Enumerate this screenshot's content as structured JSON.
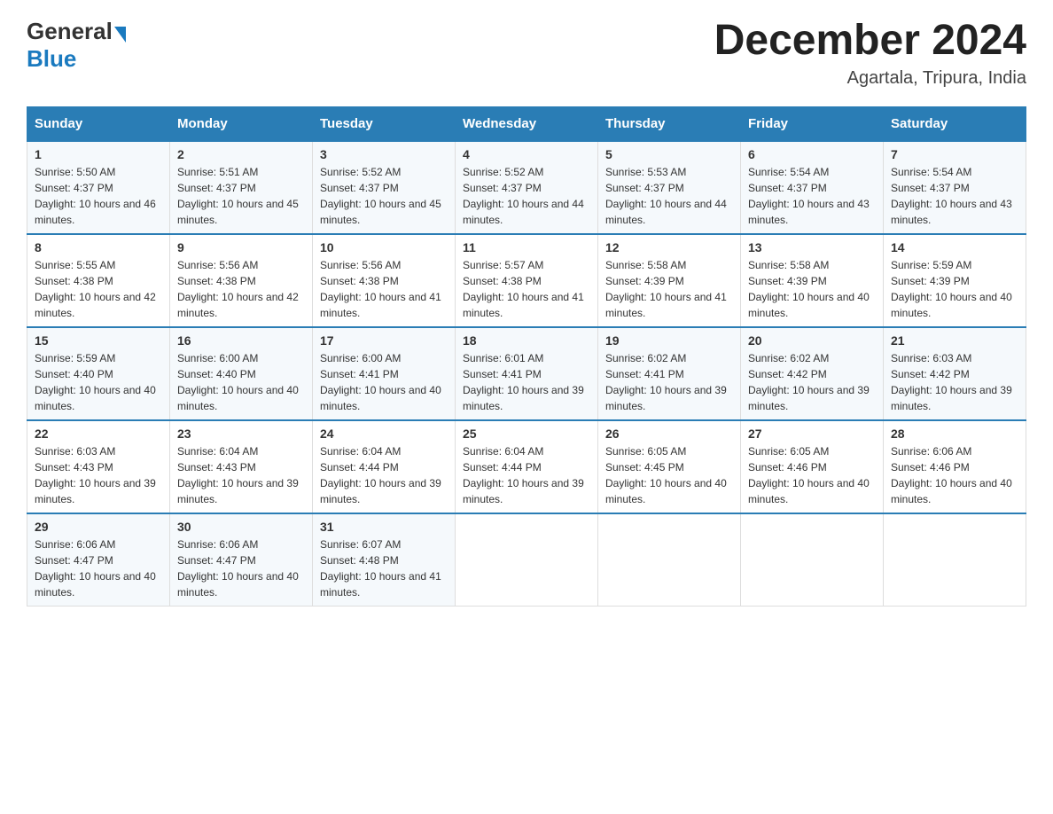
{
  "header": {
    "logo": {
      "general": "General",
      "blue": "Blue",
      "triangle": "▶"
    },
    "title": "December 2024",
    "subtitle": "Agartala, Tripura, India"
  },
  "calendar": {
    "headers": [
      "Sunday",
      "Monday",
      "Tuesday",
      "Wednesday",
      "Thursday",
      "Friday",
      "Saturday"
    ],
    "weeks": [
      [
        {
          "day": "1",
          "sunrise": "5:50 AM",
          "sunset": "4:37 PM",
          "daylight": "10 hours and 46 minutes."
        },
        {
          "day": "2",
          "sunrise": "5:51 AM",
          "sunset": "4:37 PM",
          "daylight": "10 hours and 45 minutes."
        },
        {
          "day": "3",
          "sunrise": "5:52 AM",
          "sunset": "4:37 PM",
          "daylight": "10 hours and 45 minutes."
        },
        {
          "day": "4",
          "sunrise": "5:52 AM",
          "sunset": "4:37 PM",
          "daylight": "10 hours and 44 minutes."
        },
        {
          "day": "5",
          "sunrise": "5:53 AM",
          "sunset": "4:37 PM",
          "daylight": "10 hours and 44 minutes."
        },
        {
          "day": "6",
          "sunrise": "5:54 AM",
          "sunset": "4:37 PM",
          "daylight": "10 hours and 43 minutes."
        },
        {
          "day": "7",
          "sunrise": "5:54 AM",
          "sunset": "4:37 PM",
          "daylight": "10 hours and 43 minutes."
        }
      ],
      [
        {
          "day": "8",
          "sunrise": "5:55 AM",
          "sunset": "4:38 PM",
          "daylight": "10 hours and 42 minutes."
        },
        {
          "day": "9",
          "sunrise": "5:56 AM",
          "sunset": "4:38 PM",
          "daylight": "10 hours and 42 minutes."
        },
        {
          "day": "10",
          "sunrise": "5:56 AM",
          "sunset": "4:38 PM",
          "daylight": "10 hours and 41 minutes."
        },
        {
          "day": "11",
          "sunrise": "5:57 AM",
          "sunset": "4:38 PM",
          "daylight": "10 hours and 41 minutes."
        },
        {
          "day": "12",
          "sunrise": "5:58 AM",
          "sunset": "4:39 PM",
          "daylight": "10 hours and 41 minutes."
        },
        {
          "day": "13",
          "sunrise": "5:58 AM",
          "sunset": "4:39 PM",
          "daylight": "10 hours and 40 minutes."
        },
        {
          "day": "14",
          "sunrise": "5:59 AM",
          "sunset": "4:39 PM",
          "daylight": "10 hours and 40 minutes."
        }
      ],
      [
        {
          "day": "15",
          "sunrise": "5:59 AM",
          "sunset": "4:40 PM",
          "daylight": "10 hours and 40 minutes."
        },
        {
          "day": "16",
          "sunrise": "6:00 AM",
          "sunset": "4:40 PM",
          "daylight": "10 hours and 40 minutes."
        },
        {
          "day": "17",
          "sunrise": "6:00 AM",
          "sunset": "4:41 PM",
          "daylight": "10 hours and 40 minutes."
        },
        {
          "day": "18",
          "sunrise": "6:01 AM",
          "sunset": "4:41 PM",
          "daylight": "10 hours and 39 minutes."
        },
        {
          "day": "19",
          "sunrise": "6:02 AM",
          "sunset": "4:41 PM",
          "daylight": "10 hours and 39 minutes."
        },
        {
          "day": "20",
          "sunrise": "6:02 AM",
          "sunset": "4:42 PM",
          "daylight": "10 hours and 39 minutes."
        },
        {
          "day": "21",
          "sunrise": "6:03 AM",
          "sunset": "4:42 PM",
          "daylight": "10 hours and 39 minutes."
        }
      ],
      [
        {
          "day": "22",
          "sunrise": "6:03 AM",
          "sunset": "4:43 PM",
          "daylight": "10 hours and 39 minutes."
        },
        {
          "day": "23",
          "sunrise": "6:04 AM",
          "sunset": "4:43 PM",
          "daylight": "10 hours and 39 minutes."
        },
        {
          "day": "24",
          "sunrise": "6:04 AM",
          "sunset": "4:44 PM",
          "daylight": "10 hours and 39 minutes."
        },
        {
          "day": "25",
          "sunrise": "6:04 AM",
          "sunset": "4:44 PM",
          "daylight": "10 hours and 39 minutes."
        },
        {
          "day": "26",
          "sunrise": "6:05 AM",
          "sunset": "4:45 PM",
          "daylight": "10 hours and 40 minutes."
        },
        {
          "day": "27",
          "sunrise": "6:05 AM",
          "sunset": "4:46 PM",
          "daylight": "10 hours and 40 minutes."
        },
        {
          "day": "28",
          "sunrise": "6:06 AM",
          "sunset": "4:46 PM",
          "daylight": "10 hours and 40 minutes."
        }
      ],
      [
        {
          "day": "29",
          "sunrise": "6:06 AM",
          "sunset": "4:47 PM",
          "daylight": "10 hours and 40 minutes."
        },
        {
          "day": "30",
          "sunrise": "6:06 AM",
          "sunset": "4:47 PM",
          "daylight": "10 hours and 40 minutes."
        },
        {
          "day": "31",
          "sunrise": "6:07 AM",
          "sunset": "4:48 PM",
          "daylight": "10 hours and 41 minutes."
        },
        null,
        null,
        null,
        null
      ]
    ]
  }
}
